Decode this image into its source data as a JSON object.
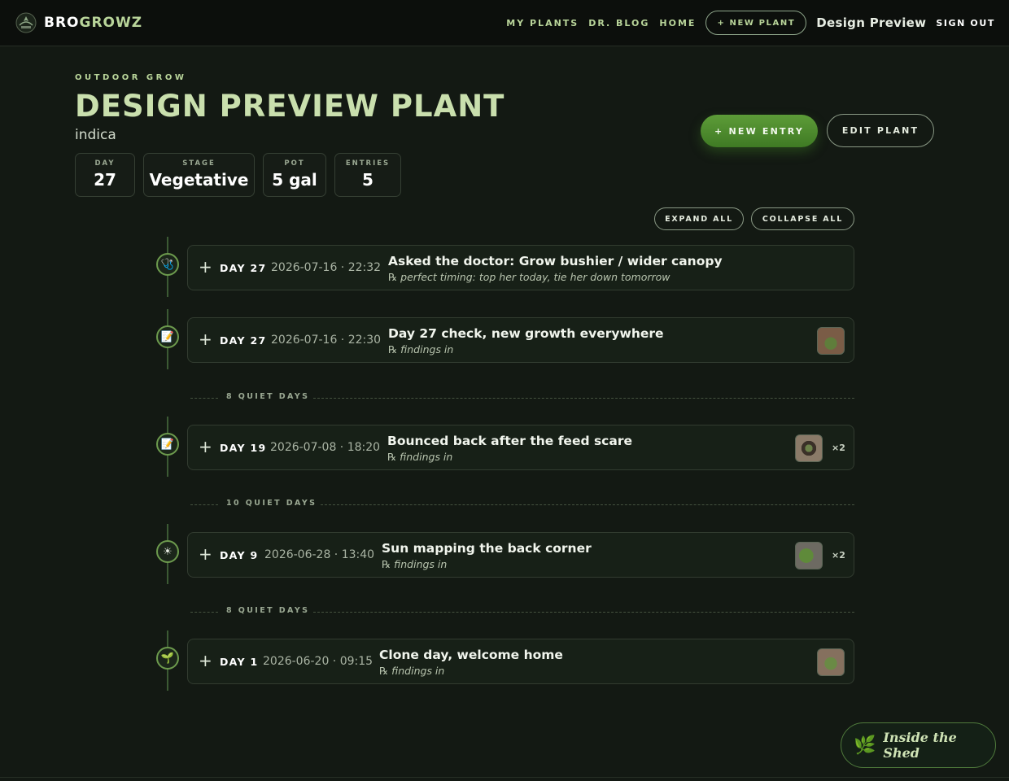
{
  "nav": {
    "brand_bro": "BRO",
    "brand_growz": "GROWZ",
    "links": [
      "MY PLANTS",
      "DR. BLOG",
      "HOME"
    ],
    "new_plant": "+ NEW PLANT",
    "user": "Design Preview",
    "sign_out": "SIGN OUT"
  },
  "plant": {
    "kicker": "OUTDOOR GROW",
    "title": "DESIGN PREVIEW PLANT",
    "strain": "indica"
  },
  "stats": [
    {
      "label": "DAY",
      "value": "27"
    },
    {
      "label": "STAGE",
      "value": "Vegetative"
    },
    {
      "label": "POT",
      "value": "5 gal"
    },
    {
      "label": "ENTRIES",
      "value": "5"
    }
  ],
  "actions": {
    "new_entry": "+ NEW ENTRY",
    "edit_plant": "EDIT PLANT",
    "expand_all": "EXPAND ALL",
    "collapse_all": "COLLAPSE ALL"
  },
  "entries": [
    {
      "icon": "stethoscope-icon",
      "glyph": "🩺",
      "day": "DAY 27",
      "date": "2026-07-16 · 22:32",
      "title": "Asked the doctor: Grow bushier / wider canopy",
      "sub": "℞ perfect timing: top her today, tie her down tomorrow",
      "photos": 0,
      "count": ""
    },
    {
      "icon": "notepad-icon",
      "glyph": "📝",
      "day": "DAY 27",
      "date": "2026-07-16 · 22:30",
      "title": "Day 27 check, new growth everywhere",
      "sub": "℞ findings in",
      "photos": 1,
      "count": ""
    },
    {
      "icon": "notepad-icon",
      "glyph": "📝",
      "day": "DAY 19",
      "date": "2026-07-08 · 18:20",
      "title": "Bounced back after the feed scare",
      "sub": "℞ findings in",
      "photos": 1,
      "count": "×2"
    },
    {
      "icon": "sun-icon",
      "glyph": "☀",
      "day": "DAY 9",
      "date": "2026-06-28 · 13:40",
      "title": "Sun mapping the back corner",
      "sub": "℞ findings in",
      "photos": 1,
      "count": "×2"
    },
    {
      "icon": "seedling-icon",
      "glyph": "🌱",
      "day": "DAY 1",
      "date": "2026-06-20 · 09:15",
      "title": "Clone day, welcome home",
      "sub": "℞ findings in",
      "photos": 1,
      "count": ""
    }
  ],
  "gaps": [
    "8 QUIET DAYS",
    "10 QUIET DAYS",
    "8 QUIET DAYS"
  ],
  "footer": {
    "badge": "Inside the Shed",
    "badge_icon": "leaf-icon"
  },
  "colors": {
    "background": "#131913",
    "accent_green": "#4f8c2e",
    "title_green": "#c9dfad"
  }
}
